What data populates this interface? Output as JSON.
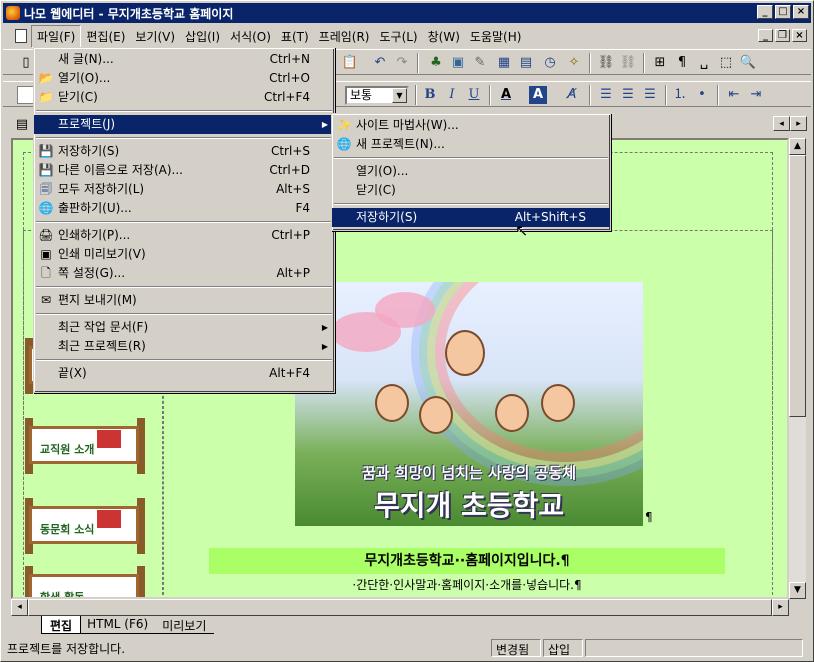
{
  "window": {
    "title": "나모 웹에디터 - 무지개초등학교 홈페이지"
  },
  "menubar": {
    "items": [
      "파일(F)",
      "편집(E)",
      "보기(V)",
      "삽입(I)",
      "서식(O)",
      "표(T)",
      "프레임(R)",
      "도구(L)",
      "창(W)",
      "도움말(H)"
    ]
  },
  "toolbar": {
    "font_size": "보통"
  },
  "file_menu": {
    "items": [
      {
        "label": "새 글(N)...",
        "shortcut": "Ctrl+N",
        "icon": "new-doc-icon"
      },
      {
        "label": "열기(O)...",
        "shortcut": "Ctrl+O",
        "icon": "open-folder-icon"
      },
      {
        "label": "닫기(C)",
        "shortcut": "Ctrl+F4",
        "icon": "close-folder-icon"
      },
      {
        "label": "프로젝트(J)",
        "submenu": true
      },
      {
        "label": "저장하기(S)",
        "shortcut": "Ctrl+S",
        "icon": "save-icon"
      },
      {
        "label": "다른 이름으로 저장(A)...",
        "shortcut": "Ctrl+D",
        "icon": "save-as-icon"
      },
      {
        "label": "모두 저장하기(L)",
        "shortcut": "Alt+S",
        "icon": "save-all-icon"
      },
      {
        "label": "출판하기(U)...",
        "shortcut": "F4",
        "icon": "publish-icon"
      },
      {
        "label": "인쇄하기(P)...",
        "shortcut": "Ctrl+P",
        "icon": "print-icon"
      },
      {
        "label": "인쇄 미리보기(V)",
        "icon": "print-preview-icon"
      },
      {
        "label": "쪽 설정(G)...",
        "shortcut": "Alt+P",
        "icon": "page-setup-icon"
      },
      {
        "label": "편지 보내기(M)",
        "icon": "mail-icon"
      },
      {
        "label": "최근 작업 문서(F)",
        "submenu": true
      },
      {
        "label": "최근 프로젝트(R)",
        "submenu": true
      },
      {
        "label": "끝(X)",
        "shortcut": "Alt+F4"
      }
    ]
  },
  "project_menu": {
    "items": [
      {
        "label": "사이트 마법사(W)...",
        "icon": "site-wizard-icon"
      },
      {
        "label": "새 프로젝트(N)...",
        "icon": "new-project-icon"
      },
      {
        "label": "열기(O)..."
      },
      {
        "label": "닫기(C)"
      },
      {
        "label": "저장하기(S)",
        "shortcut": "Alt+Shift+S"
      }
    ]
  },
  "page": {
    "photo_caption_small": "꿈과 희망이 넘치는 사랑의 공동체",
    "photo_caption_large": "무지개 초등학교",
    "welcome": "무지개초등학교··홈페이지입니다.¶",
    "subline": "·간단한·인사말과·홈페이지·소개를·넣습니다.¶",
    "pilcrow": "¶",
    "nav": [
      "교직원 소개",
      "동문회 소식",
      "학생 활동"
    ]
  },
  "bottom_tabs": [
    "편집",
    "HTML (F6)",
    "미리보기"
  ],
  "status": {
    "message": "프로젝트를 저장합니다.",
    "changed": "변경됨",
    "mode": "삽입"
  }
}
